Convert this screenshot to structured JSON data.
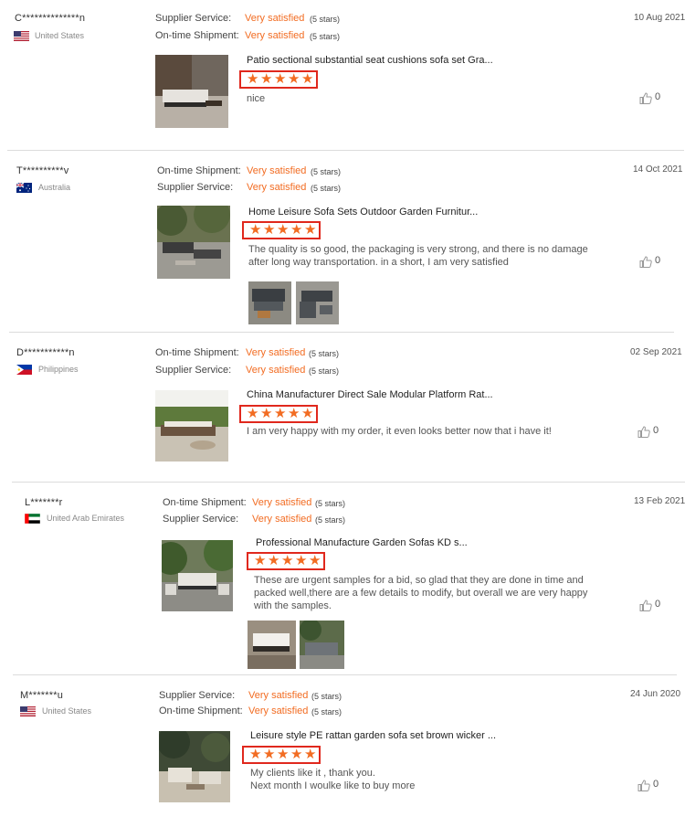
{
  "reviews": [
    {
      "user": "C**************n",
      "country": "United States",
      "flag": "us",
      "ratings": [
        {
          "label": "Supplier Service:",
          "value": "Very satisfied",
          "stars": "(5 stars)"
        },
        {
          "label": "On-time Shipment:",
          "value": "Very satisfied",
          "stars": "(5 stars)"
        }
      ],
      "date": "10 Aug 2021",
      "product": "Patio sectional substantial seat cushions sofa set Gra...",
      "comment": "nice",
      "likes": "0"
    },
    {
      "user": "T**********v",
      "country": "Australia",
      "flag": "au",
      "ratings": [
        {
          "label": "On-time Shipment:",
          "value": "Very satisfied",
          "stars": "(5 stars)"
        },
        {
          "label": "Supplier Service:",
          "value": "Very satisfied",
          "stars": "(5 stars)"
        }
      ],
      "date": "14 Oct 2021",
      "product": "Home Leisure Sofa Sets Outdoor Garden Furnitur...",
      "comment": "The quality is so good, the packaging is very strong, and there is no damage after long way transportation. in a short, I am very satisfied",
      "likes": "0"
    },
    {
      "user": "D***********n",
      "country": "Philippines",
      "flag": "ph",
      "ratings": [
        {
          "label": "On-time Shipment:",
          "value": "Very satisfied",
          "stars": "(5 stars)"
        },
        {
          "label": "Supplier Service:",
          "value": "Very satisfied",
          "stars": "(5 stars)"
        }
      ],
      "date": "02 Sep 2021",
      "product": "China Manufacturer Direct Sale Modular Platform Rat...",
      "comment": "I am very happy with my order, it even looks better now that i have it!",
      "likes": "0"
    },
    {
      "user": "L*******r",
      "country": "United Arab Emirates",
      "flag": "ae",
      "ratings": [
        {
          "label": "On-time Shipment:",
          "value": "Very satisfied",
          "stars": "(5 stars)"
        },
        {
          "label": "Supplier Service:",
          "value": "Very satisfied",
          "stars": "(5 stars)"
        }
      ],
      "date": "13 Feb 2021",
      "product": "Professional Manufacture Garden Sofas KD s...",
      "comment": "These are urgent samples for a bid, so glad that they are done in time and packed well,there are a few details to modify, but overall we are very happy with the samples.",
      "likes": "0"
    },
    {
      "user": "M*******u",
      "country": "United States",
      "flag": "us",
      "ratings": [
        {
          "label": "Supplier Service:",
          "value": "Very satisfied",
          "stars": "(5 stars)"
        },
        {
          "label": "On-time Shipment:",
          "value": "Very satisfied",
          "stars": "(5 stars)"
        }
      ],
      "date": "24 Jun 2020",
      "product": "Leisure style PE rattan garden sofa set brown wicker ...",
      "comment": "My clients  like it , thank you.\nNext month I woulke like to buy more",
      "likes": "0"
    }
  ],
  "star_glyph": "★",
  "colors": {
    "accent": "#f26c22",
    "highlight_box": "#e0281d"
  }
}
